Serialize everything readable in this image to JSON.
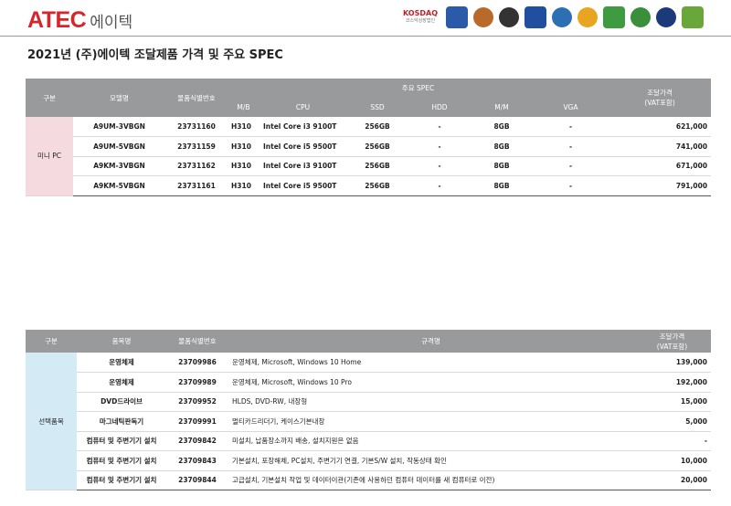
{
  "header": {
    "logo_en": "ATEC",
    "logo_kr": "에이텍",
    "certs": [
      {
        "name": "kosdaq-logo",
        "label": "KOSDAQ",
        "sub": "코스닥상장법인",
        "color": "#ffffff"
      },
      {
        "name": "cert-seal-1",
        "label": "",
        "color": "#2a5aa8"
      },
      {
        "name": "cert-seal-2",
        "label": "",
        "color": "#b86a2a"
      },
      {
        "name": "cert-seal-3",
        "label": "",
        "color": "#333333"
      },
      {
        "name": "cert-seal-4",
        "label": "",
        "color": "#1f4f9e"
      },
      {
        "name": "cert-seal-5",
        "label": "",
        "color": "#2d6fb3"
      },
      {
        "name": "cert-seal-6",
        "label": "",
        "color": "#e8a521"
      },
      {
        "name": "cert-seal-7",
        "label": "",
        "color": "#3f9b3f"
      },
      {
        "name": "cert-seal-8",
        "label": "",
        "color": "#3b8f3a"
      },
      {
        "name": "cert-seal-9",
        "label": "",
        "color": "#1a3a7a"
      },
      {
        "name": "cert-seal-10",
        "label": "",
        "color": "#6aa73a"
      }
    ]
  },
  "title": "2021년 (주)에이텍 조달제품 가격 및 주요 SPEC",
  "table1": {
    "headers": {
      "category": "구분",
      "model": "모델명",
      "item_no": "물품식별번호",
      "spec": "주요 SPEC",
      "price": "조달가격",
      "price_sub": "(VAT포함)",
      "mb": "M/B",
      "cpu": "CPU",
      "ssd": "SSD",
      "hdd": "HDD",
      "mm": "M/M",
      "vga": "VGA"
    },
    "category": "미니 PC",
    "rows": [
      {
        "model": "A9UM-3VBGN",
        "item_no": "23731160",
        "mb": "H310",
        "cpu": "Intel Core i3 9100T",
        "ssd": "256GB",
        "hdd": "-",
        "mm": "8GB",
        "vga": "-",
        "price": "621,000"
      },
      {
        "model": "A9UM-5VBGN",
        "item_no": "23731159",
        "mb": "H310",
        "cpu": "Intel Core i5 9500T",
        "ssd": "256GB",
        "hdd": "-",
        "mm": "8GB",
        "vga": "-",
        "price": "741,000"
      },
      {
        "model": "A9KM-3VBGN",
        "item_no": "23731162",
        "mb": "H310",
        "cpu": "Intel Core i3 9100T",
        "ssd": "256GB",
        "hdd": "-",
        "mm": "8GB",
        "vga": "-",
        "price": "671,000"
      },
      {
        "model": "A9KM-5VBGN",
        "item_no": "23731161",
        "mb": "H310",
        "cpu": "Intel Core i5 9500T",
        "ssd": "256GB",
        "hdd": "-",
        "mm": "8GB",
        "vga": "-",
        "price": "791,000"
      }
    ]
  },
  "table2": {
    "headers": {
      "category": "구분",
      "item": "품목명",
      "item_no": "물품식별번호",
      "spec": "규격명",
      "price": "조달가격",
      "price_sub": "(VAT포함)"
    },
    "category": "선택품목",
    "rows": [
      {
        "item": "운영체제",
        "item_no": "23709986",
        "spec": "운영체제, Microsoft, Windows 10 Home",
        "price": "139,000"
      },
      {
        "item": "운영체제",
        "item_no": "23709989",
        "spec": "운영체제, Microsoft, Windows 10 Pro",
        "price": "192,000"
      },
      {
        "item": "DVD드라이브",
        "item_no": "23709952",
        "spec": "HLDS, DVD-RW, 내장형",
        "price": "15,000"
      },
      {
        "item": "마그네틱판독기",
        "item_no": "23709991",
        "spec": "멀티카드리더기, 케이스기본내장",
        "price": "5,000"
      },
      {
        "item": "컴퓨터 및 주변기기 설치",
        "item_no": "23709842",
        "spec": "미설치, 납품장소까지 배송, 설치지원은 없음",
        "price": "-"
      },
      {
        "item": "컴퓨터 및 주변기기 설치",
        "item_no": "23709843",
        "spec": "기본설치, 포장해체, PC설치, 주변기기 연결, 기본S/W 설치, 작동상태 확인",
        "price": "10,000"
      },
      {
        "item": "컴퓨터 및 주변기기 설치",
        "item_no": "23709844",
        "spec": "고급설치, 기본설치 작업 및 데이터이관(기존에 사용하던 컴퓨터 데이터를 새 컴퓨터로 이전)",
        "price": "20,000"
      }
    ]
  }
}
